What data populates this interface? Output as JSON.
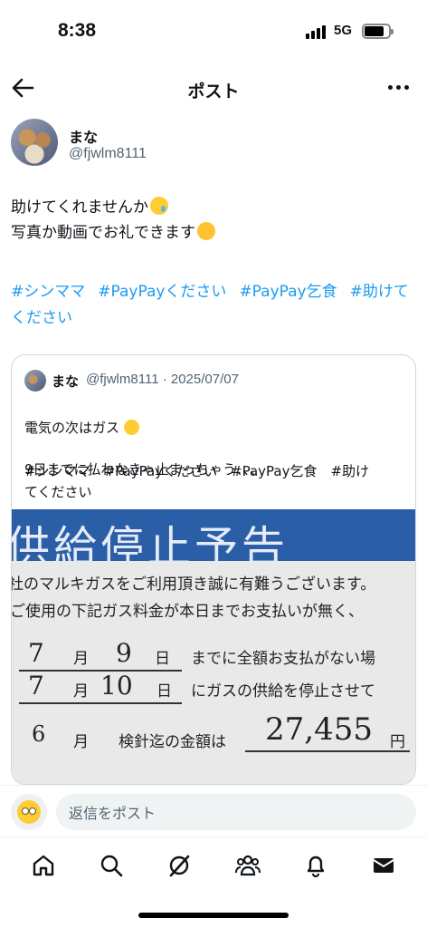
{
  "status_bar": {
    "time": "8:38",
    "network": "5G"
  },
  "header": {
    "title": "ポスト",
    "back_icon": "arrow-left-icon",
    "more_icon": "more-dots-icon"
  },
  "post": {
    "author_name": "まな",
    "author_handle": "@fjwlm8111",
    "text_line1": "助けてくれませんか",
    "text_line2": "写真か動画でお礼できます",
    "hashtags": [
      "#シンママ",
      "#PayPayください",
      "#PayPay乞食",
      "#助けてください"
    ]
  },
  "quoted_post": {
    "author_name": "まな",
    "meta": "@fjwlm8111 · 2025/07/07",
    "text_line1": "電気の次はガス",
    "text_line2": "9日までに払わなきゃ止まっちゃう、、、",
    "tags_line1": "#シンママ　#PayPayください　#PayPay乞食　#助け",
    "tags_line2": "てください",
    "image": {
      "banner": "供給停止予告",
      "line1": "社のマルキガスをご利用頂き誠に有難うございます。",
      "line2": "ご使用の下記ガス料金が本日までお支払いが無く、",
      "row1_month": "7",
      "row1_unit": "月",
      "row1_day": "9",
      "row1_day_unit": "日",
      "row1_text": "までに全額お支払がない場",
      "row2_month": "7",
      "row2_unit": "月",
      "row2_day": "10",
      "row2_day_unit": "日",
      "row2_text": "にガスの供給を停止させて",
      "row3_month": "6",
      "row3_unit": "月",
      "row3_text": "検針迄の金額は",
      "amount": "27,455",
      "amount_unit": "円"
    }
  },
  "reply": {
    "placeholder": "返信をポスト"
  },
  "nav": [
    "home-icon",
    "search-icon",
    "grok-icon",
    "communities-icon",
    "notifications-icon",
    "messages-icon"
  ]
}
